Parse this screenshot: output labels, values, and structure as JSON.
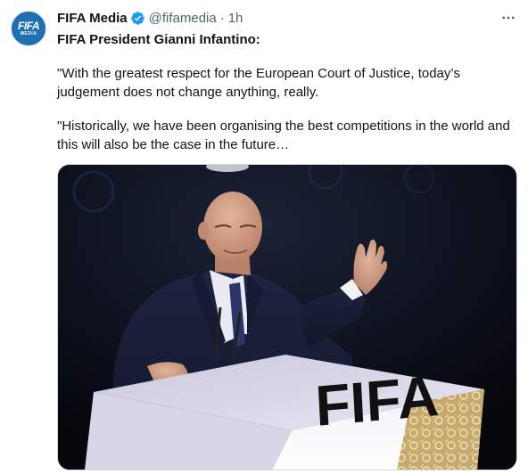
{
  "account": {
    "avatar_logo": "FIFA",
    "avatar_sub": "MEDIA",
    "display_name": "FIFA Media",
    "handle": "@fifamedia",
    "separator": "·",
    "timestamp": "1h",
    "verified_icon": "verified-badge-icon",
    "verified_color": "#1d9bf0"
  },
  "tweet": {
    "lead": "FIFA President Gianni Infantino:",
    "paragraph_1": "\"With the greatest respect for the European Court of Justice, today’s judgement does not change anything, really.",
    "paragraph_2": "\"Historically, we have been organising the best competitions in the world and this will also be the case in the future…"
  },
  "media": {
    "podium_text": "FIFA"
  },
  "colors": {
    "text_primary": "#0f1419",
    "text_secondary": "#536471",
    "border": "#cfd9de"
  }
}
